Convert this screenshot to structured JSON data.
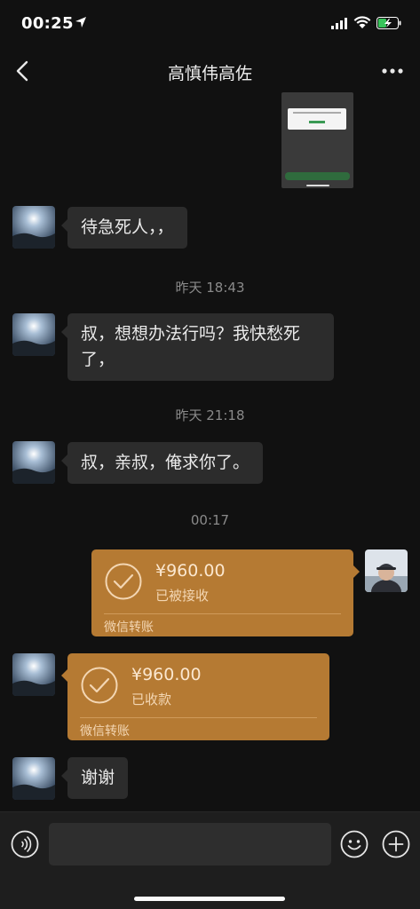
{
  "status_bar": {
    "time": "00:25",
    "icons": [
      "location-arrow-icon",
      "signal-icon",
      "wifi-icon",
      "battery-charging-icon"
    ]
  },
  "nav": {
    "title": "高慎伟高佐",
    "back_icon": "chevron-left-icon",
    "more_icon": "more-dots-icon"
  },
  "messages": [
    {
      "type": "image",
      "side": "right",
      "content": "screenshot-thumbnail"
    },
    {
      "type": "text",
      "side": "left",
      "text": "待急死人，，"
    },
    {
      "type": "timestamp",
      "text": "昨天 18:43"
    },
    {
      "type": "text",
      "side": "left",
      "text": "叔，想想办法行吗？我快愁死了，"
    },
    {
      "type": "timestamp",
      "text": "昨天 21:18"
    },
    {
      "type": "text",
      "side": "left",
      "text": "叔，亲叔，俺求你了。"
    },
    {
      "type": "timestamp",
      "text": "00:17"
    },
    {
      "type": "transfer",
      "side": "right",
      "amount": "¥960.00",
      "status": "已被接收",
      "footer": "微信转账"
    },
    {
      "type": "transfer",
      "side": "left",
      "amount": "¥960.00",
      "status": "已收款",
      "footer": "微信转账"
    },
    {
      "type": "text",
      "side": "left",
      "text": "谢谢"
    }
  ],
  "input_bar": {
    "voice_icon": "voice-icon",
    "emoji_icon": "emoji-icon",
    "plus_icon": "plus-icon",
    "placeholder": ""
  },
  "colors": {
    "background": "#111111",
    "bubble": "#2c2c2c",
    "transfer": "#b57a33",
    "timestamp": "#8a8a8a"
  }
}
